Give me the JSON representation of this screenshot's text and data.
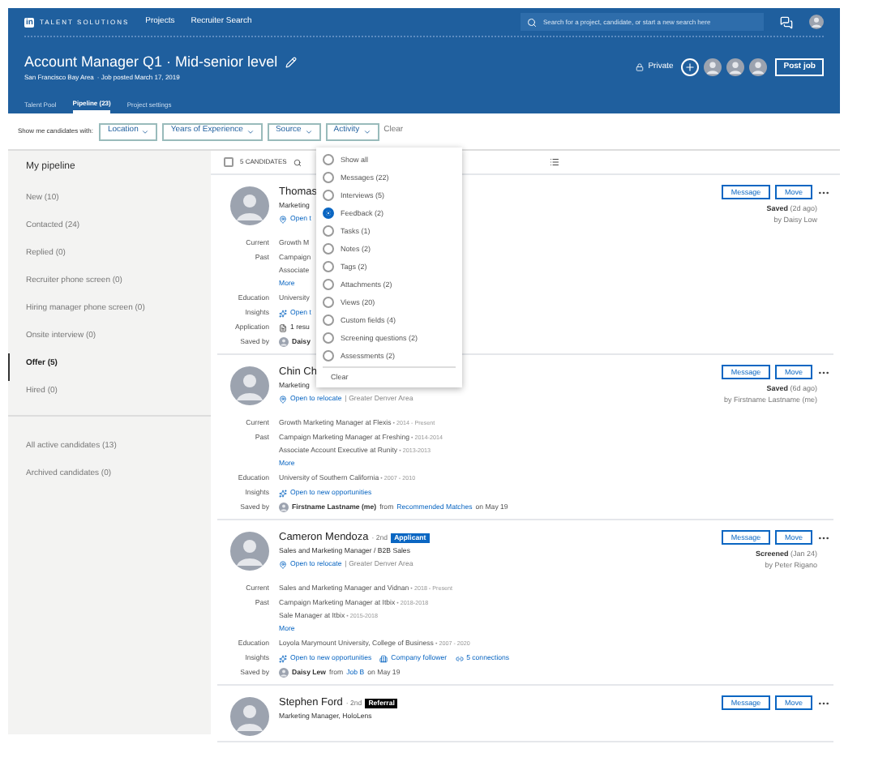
{
  "nav": {
    "logo": "in",
    "brand": "TALENT SOLUTIONS",
    "links": [
      "Projects",
      "Recruiter Search"
    ],
    "search": {
      "placeholder": "Search for a project, candidate, or start a new search here"
    }
  },
  "job": {
    "title": "Account Manager Q1 · Mid-senior level",
    "location": "San Francisco Bay Area",
    "posted": "· Job posted March 17, 2019",
    "visibility": "Private",
    "post_button": "Post job"
  },
  "tabs": [
    {
      "label": "Talent Pool",
      "selected": false
    },
    {
      "label": "Pipeline (23)",
      "selected": true
    },
    {
      "label": "Project settings",
      "selected": false
    }
  ],
  "filters": {
    "label": "Show me candidates with:",
    "dropdowns": [
      "Location",
      "Years of Experience",
      "Source",
      "Activity"
    ],
    "clear": "Clear"
  },
  "sidebar": {
    "title": "My pipeline",
    "stages": [
      {
        "label": "New (10)",
        "selected": false
      },
      {
        "label": "Contacted (24)",
        "selected": false
      },
      {
        "label": "Replied (0)",
        "selected": false
      },
      {
        "label": "Recruiter phone screen (0)",
        "selected": false
      },
      {
        "label": "Hiring manager phone screen (0)",
        "selected": false
      },
      {
        "label": "Onsite interview (0)",
        "selected": false
      },
      {
        "label": "Offer (5)",
        "selected": true
      },
      {
        "label": "Hired (0)",
        "selected": false
      }
    ],
    "other": [
      "All active candidates (13)",
      "Archived candidates (0)"
    ]
  },
  "list": {
    "count": "5 CANDIDATES",
    "select_all": {
      "checked": false
    }
  },
  "candidates": [
    {
      "name": "Thomas",
      "headline": "Marketing",
      "location_link": "Open t",
      "details": [
        {
          "label": "Current",
          "lines": [
            {
              "text": "Growth M"
            }
          ]
        },
        {
          "label": "Past",
          "lines": [
            {
              "text": "Campaign"
            },
            {
              "text": "Associate"
            }
          ],
          "more": "More"
        },
        {
          "label": "Education",
          "lines": [
            {
              "text": "University"
            }
          ]
        },
        {
          "label": "Insights",
          "links": [
            "Open t"
          ]
        },
        {
          "label": "Application",
          "links": [
            "1 resu"
          ]
        },
        {
          "label": "Saved by",
          "saver": "Daisy"
        }
      ],
      "buttons": [
        "Message",
        "Move"
      ],
      "status": {
        "word": "Saved",
        "when": "(2d ago)",
        "by": "by Daisy Low"
      }
    },
    {
      "name": "Chin Ch",
      "headline": "Marketing",
      "location_link": "Open to relocate",
      "location": "| Greater Denver Area",
      "details": [
        {
          "label": "Current",
          "lines": [
            {
              "text": "Growth Marketing Manager at Flexis",
              "dates": "• 2014 - Present"
            }
          ]
        },
        {
          "label": "Past",
          "lines": [
            {
              "text": "Campaign Marketing Manager at Freshing",
              "dates": "• 2014-2014"
            },
            {
              "text": "Associate Account Executive at Runity",
              "dates": "• 2013-2013"
            }
          ],
          "more": "More"
        },
        {
          "label": "Education",
          "lines": [
            {
              "text": "University of Southern California",
              "dates": "• 2007 - 2010"
            }
          ]
        },
        {
          "label": "Insights",
          "links": [
            "Open to new opportunities"
          ]
        },
        {
          "label": "Saved by",
          "saver": "Firstname Lastname (me)",
          "from": "from",
          "source": "Recommended Matches",
          "date": "on May 19"
        }
      ],
      "buttons": [
        "Message",
        "Move"
      ],
      "status": {
        "word": "Saved",
        "when": "(6d ago)",
        "by": "by Firstname Lastname (me)"
      }
    },
    {
      "name": "Cameron Mendoza",
      "degree": "· 2nd",
      "badge": {
        "text": "Applicant",
        "kind": "applicant"
      },
      "headline": "Sales and Marketing Manager / B2B Sales",
      "location_link": "Open to relocate",
      "location": "| Greater Denver Area",
      "details": [
        {
          "label": "Current",
          "lines": [
            {
              "text": "Sales and Marketing Manager and Vidnan",
              "dates": "• 2018 - Present"
            }
          ]
        },
        {
          "label": "Past",
          "lines": [
            {
              "text": "Campaign Marketing Manager at Itbix",
              "dates": "• 2018-2018"
            },
            {
              "text": "Sale Manager at Itbix",
              "dates": "• 2015-2018"
            }
          ],
          "more": "More"
        },
        {
          "label": "Education",
          "lines": [
            {
              "text": "Loyola Marymount University, College of Business",
              "dates": "• 2007 - 2020"
            }
          ]
        },
        {
          "label": "Insights",
          "links": [
            "Open to new opportunities",
            "Company follower",
            "5 connections"
          ]
        },
        {
          "label": "Saved by",
          "saver": "Daisy Lew",
          "from": "from",
          "source": "Job B",
          "date": "on May 19"
        }
      ],
      "buttons": [
        "Message",
        "Move"
      ],
      "status": {
        "word": "Screened",
        "when": "(Jan 24)",
        "by": "by Peter Rigano"
      }
    },
    {
      "name": "Stephen Ford",
      "degree": "· 2nd",
      "badge": {
        "text": "Referral",
        "kind": "referral"
      },
      "headline": "Marketing Manager, HoloLens",
      "buttons": [
        "Message",
        "Move"
      ]
    }
  ],
  "activity_menu": {
    "options": [
      {
        "label": "Show all",
        "selected": false
      },
      {
        "label": "Messages (22)",
        "selected": false
      },
      {
        "label": "Interviews (5)",
        "selected": false
      },
      {
        "label": "Feedback (2)",
        "selected": true
      },
      {
        "label": "Tasks (1)",
        "selected": false
      },
      {
        "label": "Notes (2)",
        "selected": false
      },
      {
        "label": "Tags (2)",
        "selected": false
      },
      {
        "label": "Attachments (2)",
        "selected": false
      },
      {
        "label": "Views (20)",
        "selected": false
      },
      {
        "label": "Custom fields (4)",
        "selected": false
      },
      {
        "label": "Screening questions (2)",
        "selected": false
      },
      {
        "label": "Assessments (2)",
        "selected": false
      }
    ],
    "clear": "Clear"
  }
}
